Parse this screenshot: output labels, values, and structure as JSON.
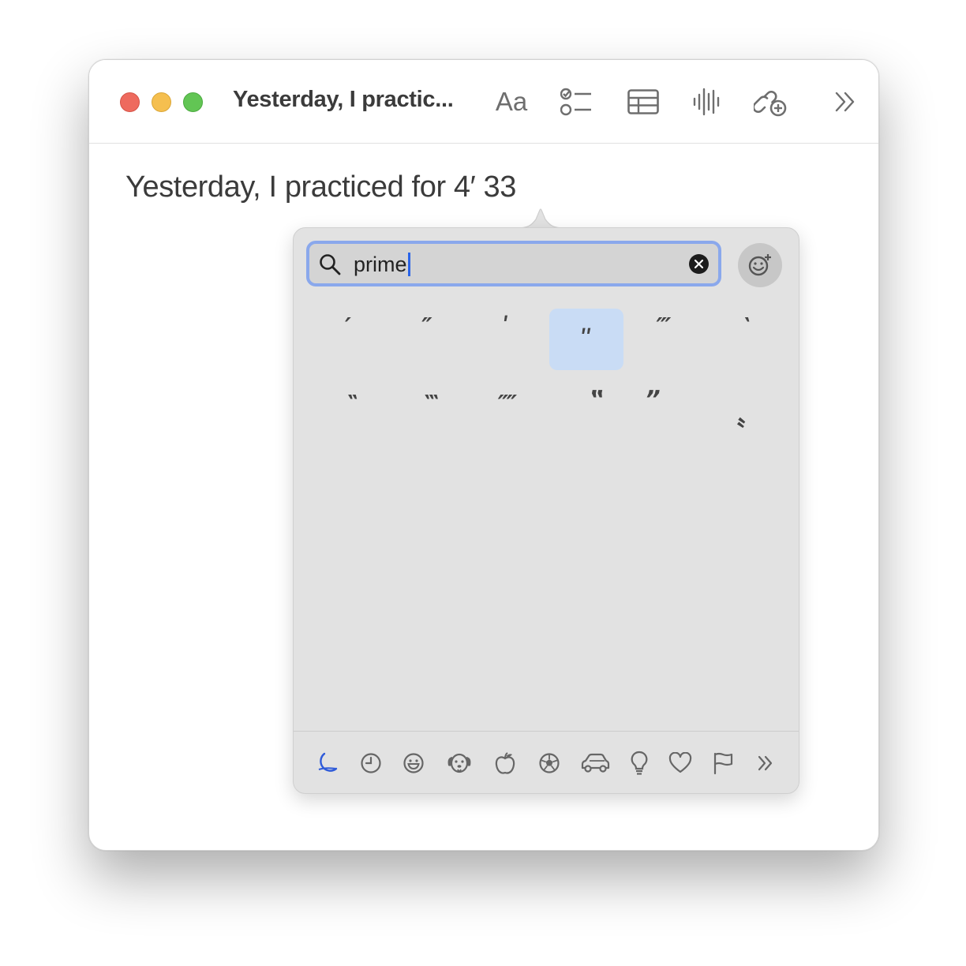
{
  "window": {
    "title": "Yesterday, I practic...",
    "toolbar": {
      "format_label": "Aa"
    }
  },
  "note": {
    "text": "Yesterday, I practiced for 4′ 33"
  },
  "emoji_picker": {
    "search": {
      "value": "prime"
    },
    "results": [
      {
        "char": "′",
        "selected": false
      },
      {
        "char": "″",
        "selected": false
      },
      {
        "char": "ʹ",
        "selected": false
      },
      {
        "char": "ʺ",
        "selected": true
      },
      {
        "char": "‴",
        "selected": false
      },
      {
        "char": "‵",
        "selected": false
      },
      {
        "char": "‶",
        "selected": false
      },
      {
        "char": "‷",
        "selected": false
      },
      {
        "char": "⁗",
        "selected": false
      },
      {
        "char": "‟",
        "selected": false
      },
      {
        "char": "”",
        "selected": false
      },
      {
        "char": "〝",
        "selected": false
      }
    ],
    "categories": [
      {
        "icon": "crescent-sticker-icon",
        "active": true
      },
      {
        "icon": "clock-icon",
        "active": false
      },
      {
        "icon": "smiley-icon",
        "active": false
      },
      {
        "icon": "dog-icon",
        "active": false
      },
      {
        "icon": "apple-icon",
        "active": false
      },
      {
        "icon": "soccer-ball-icon",
        "active": false
      },
      {
        "icon": "car-icon",
        "active": false
      },
      {
        "icon": "lightbulb-icon",
        "active": false
      },
      {
        "icon": "heart-icon",
        "active": false
      },
      {
        "icon": "flag-icon",
        "active": false
      },
      {
        "icon": "chevron-double-right-icon",
        "active": false
      }
    ],
    "colors": {
      "accent": "#2a64e8",
      "selection": "#c9dcf5",
      "active_category": "#2f5bd9"
    }
  }
}
